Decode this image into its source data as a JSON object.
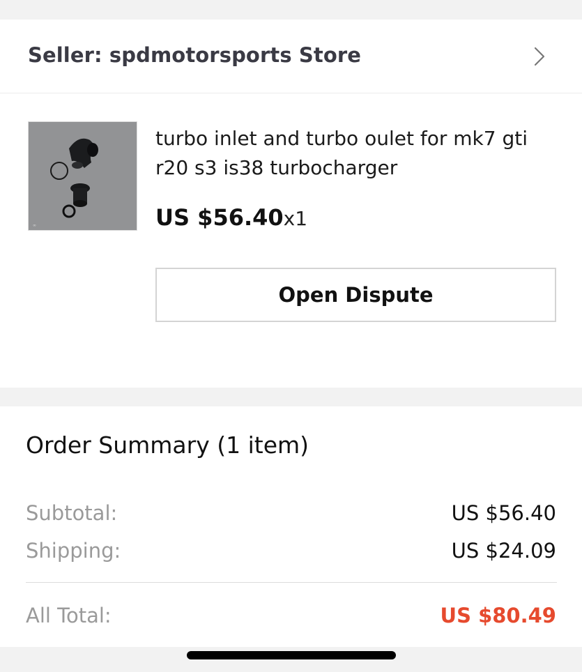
{
  "seller": {
    "label": "Seller: spdmotorsports Store",
    "chevron_icon": "chevron-right-icon"
  },
  "product": {
    "image_icon": "product-thumbnail",
    "title_line1": "turbo inlet and turbo oulet for mk7 gti",
    "title_line2": "r20 s3 is38 turbocharger",
    "price": "US $56.40",
    "quantity": "x1",
    "dispute_label": "Open Dispute"
  },
  "summary": {
    "title": "Order Summary (1 item)",
    "subtotal_label": "Subtotal:",
    "subtotal_value": "US $56.40",
    "shipping_label": "Shipping:",
    "shipping_value": "US $24.09",
    "total_label": "All Total:",
    "total_value": "US $80.49"
  },
  "colors": {
    "total_accent": "#e64a2e",
    "background": "#f2f2f2"
  }
}
